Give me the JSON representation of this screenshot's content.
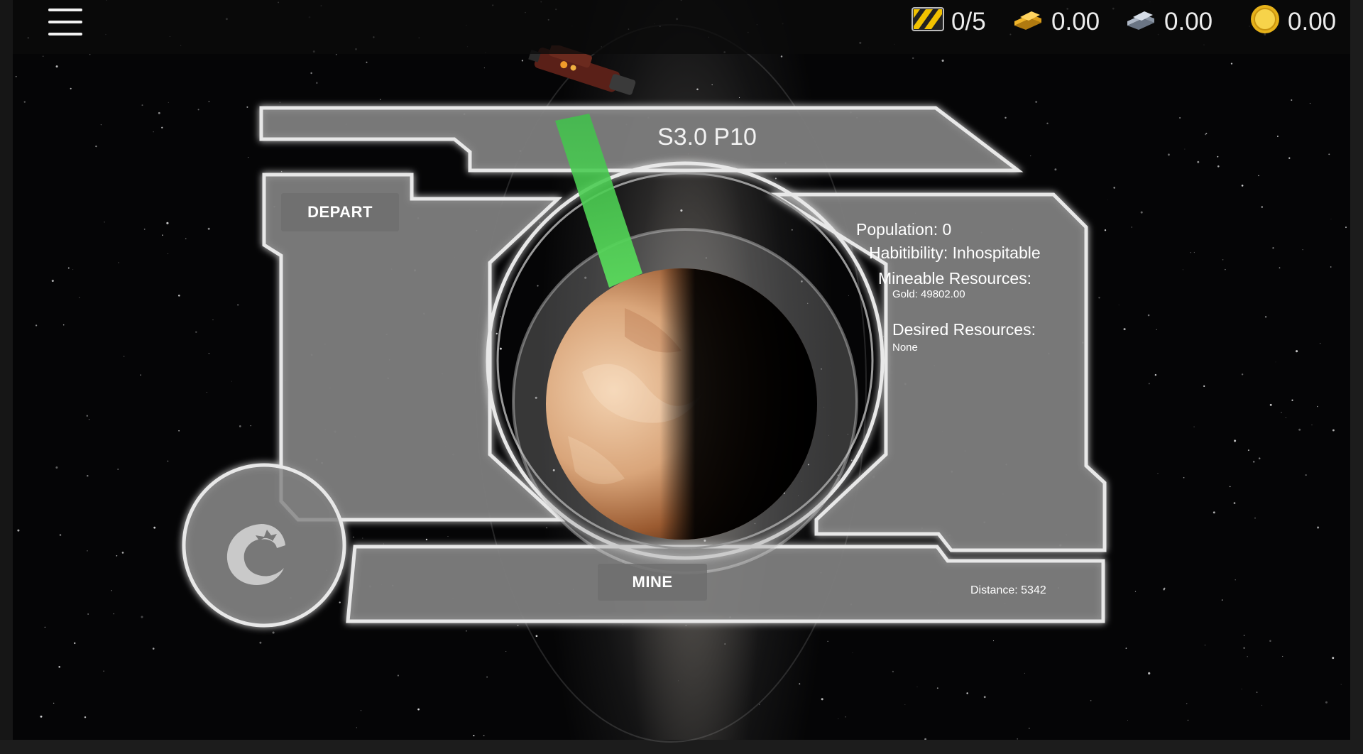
{
  "topbar": {
    "menu_icon": "hamburger-menu-icon",
    "cargo": {
      "icon": "cargo-hazard-icon",
      "value": "0/5"
    },
    "gold": {
      "icon": "gold-bars-icon",
      "value": "0.00"
    },
    "silver": {
      "icon": "silver-bars-icon",
      "value": "0.00"
    },
    "credits": {
      "icon": "gold-coin-icon",
      "value": "0.00"
    }
  },
  "planet": {
    "name": "S3.0 P10",
    "population": "Population: 0",
    "habitability": "Habitibility: Inhospitable",
    "mineable_heading": "Mineable Resources:",
    "mineable_items": [
      "Gold: 49802.00"
    ],
    "desired_heading": "Desired Resources:",
    "desired_items": [
      "None"
    ],
    "distance": "Distance: 5342"
  },
  "actions": {
    "depart_label": "DEPART",
    "mine_label": "MINE"
  },
  "colors": {
    "panel": "#808080",
    "panel_glow": "#e8e8e8",
    "beam": "#3fc24a",
    "planet_lit": "#e2b48a"
  }
}
